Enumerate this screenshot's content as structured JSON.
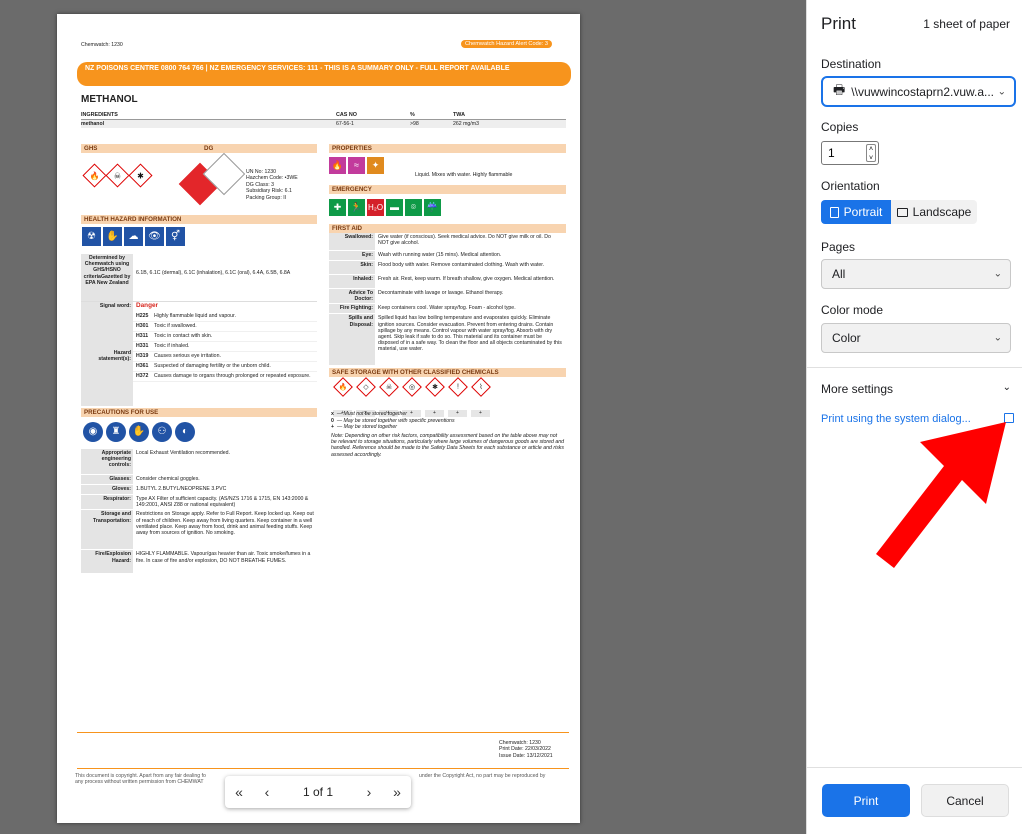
{
  "document": {
    "chemwatch_id": "Chemwatch: 1230",
    "alert_code": "Chemwatch Hazard Alert Code: 3",
    "banner": "NZ POISONS CENTRE 0800 764 766 | NZ EMERGENCY SERVICES: 111 - THIS IS A SUMMARY ONLY - FULL REPORT AVAILABLE",
    "title": "METHANOL",
    "ingredients_headers": [
      "INGREDIENTS",
      "CAS NO",
      "%",
      "TWA"
    ],
    "ingredients_row": [
      "methanol",
      "67-56-1",
      ">98",
      "262 mg/m3"
    ],
    "ghs_label": "GHS",
    "dg_label": "DG",
    "dg_info": [
      "UN No: 1230",
      "Hazchem Code: •3WE",
      "DG Class: 3",
      "Subsidiary Risk: 6.1",
      "Packing Group: II"
    ],
    "health_header": "HEALTH HAZARD INFORMATION",
    "determined_label": "Determined by Chemwatch using GHS/HSNO criteriaGazetted by EPA New Zealand",
    "determined_value": "6.1B, 6.1C (dermal), 6.1C (inhalation), 6.1C (oral), 6.4A, 6.5B, 6.8A",
    "signal_label": "Signal word:",
    "signal_value": "Danger",
    "hazard_label": "Hazard statement(s):",
    "hazards": [
      {
        "code": "H225",
        "text": "Highly flammable liquid and vapour."
      },
      {
        "code": "H301",
        "text": "Toxic if swallowed."
      },
      {
        "code": "H311",
        "text": "Toxic in contact with skin."
      },
      {
        "code": "H331",
        "text": "Toxic if inhaled."
      },
      {
        "code": "H319",
        "text": "Causes serious eye irritation."
      },
      {
        "code": "H361",
        "text": "Suspected of damaging fertility or the unborn child."
      },
      {
        "code": "H372",
        "text": "Causes damage to organs through prolonged or repeated exposure."
      }
    ],
    "precautions_header": "PRECAUTIONS FOR USE",
    "precautions": [
      {
        "label": "Appropriate engineering controls:",
        "value": "Local Exhaust Ventilation recommended."
      },
      {
        "label": "Glasses:",
        "value": "Consider chemical goggles."
      },
      {
        "label": "Gloves:",
        "value": "1.BUTYL 2.BUTYL/NEOPRENE 3.PVC"
      },
      {
        "label": "Respirator:",
        "value": "Type AX Filter of sufficient capacity. (AS/NZS 1716 & 1715, EN 143:2000 & 149:2001, ANSI Z88 or national equivalent)"
      },
      {
        "label": "Storage and Transportation:",
        "value": "Restrictions on Storage apply. Refer to Full Report. Keep locked up. Keep out of reach of children. Keep away from living quarters. Keep container in a well ventilated place. Keep away from food, drink and animal feeding stuffs. Keep away from sources of ignition. No smoking."
      },
      {
        "label": "Fire/Explosion Hazard:",
        "value": "HIGHLY FLAMMABLE. Vapour/gas heavier than air. Toxic smoke/fumes in a fire. In case of fire and/or explosion, DO NOT BREATHE FUMES."
      }
    ],
    "properties_header": "PROPERTIES",
    "properties_text": "Liquid. Mixes with water. Highly flammable",
    "emergency_header": "EMERGENCY",
    "firstaid_header": "FIRST AID",
    "firstaid": [
      {
        "label": "Swallowed:",
        "value": "Give water (if conscious). Seek medical advice. Do NOT give milk or oil. Do NOT give alcohol."
      },
      {
        "label": "Eye:",
        "value": "Wash with running water (15 mins). Medical attention."
      },
      {
        "label": "Skin:",
        "value": "Flood body with water. Remove contaminated clothing. Wash with water."
      },
      {
        "label": "Inhaled:",
        "value": "Fresh air. Rest, keep warm. If breath shallow, give oxygen. Medical attention."
      },
      {
        "label": "Advice To Doctor:",
        "value": "Decontaminate with lavage or lavage. Ethanol therapy."
      },
      {
        "label": "Fire Fighting:",
        "value": "Keep containers cool. Water spray/fog. Foam - alcohol type."
      },
      {
        "label": "Spills and Disposal:",
        "value": "Spilled liquid has low boiling temperature and evaporates quickly. Eliminate ignition sources. Consider evacuation. Prevent from entering drains. Contain spillage by any means. Control vapour with water spray/fog. Absorb with dry agent. Skip leak if safe to do so. This material and its container must be disposed of in a safe way. To clean the floor and all objects contaminated by this material, use water."
      }
    ],
    "storage_header": "SAFE STORAGE WITH OTHER CLASSIFIED CHEMICALS",
    "storage_symbols": [
      "+",
      "x",
      "+",
      "+",
      "+",
      "+",
      "+"
    ],
    "legend": [
      {
        "sym": "x",
        "text": "— Must not be stored together"
      },
      {
        "sym": "0",
        "text": "— May be stored together with specific preventions"
      },
      {
        "sym": "+",
        "text": "— May be stored together"
      }
    ],
    "note": "Note: Depending on other risk factors, compatibility assessment based on the table above may not be relevant to storage situations, particularly where large volumes of dangerous goods are stored and handled. Reference should be made to the Safety Data Sheets for each substance or article and risks assessed accordingly.",
    "footer_info": [
      "Chemwatch: 1230",
      "Print Date: 22/03/2022",
      "Issue Date: 13/12/2021"
    ],
    "copyright_left": "This document is copyright. Apart from any fair dealing fo",
    "copyright_left2": "any process without written permission from CHEMWAT",
    "copyright_right": "under the Copyright Act, no part may be reproduced by"
  },
  "pager": {
    "first": "«",
    "prev": "‹",
    "page": "1 of 1",
    "next": "›",
    "last": "»"
  },
  "panel": {
    "title": "Print",
    "sheets": "1 sheet of paper",
    "destination_label": "Destination",
    "destination_value": "\\\\vuwwincostaprn2.vuw.a...",
    "copies_label": "Copies",
    "copies_value": "1",
    "orientation_label": "Orientation",
    "portrait": "Portrait",
    "landscape": "Landscape",
    "pages_label": "Pages",
    "pages_value": "All",
    "color_label": "Color mode",
    "color_value": "Color",
    "more_settings": "More settings",
    "system_dialog": "Print using the system dialog...",
    "print_button": "Print",
    "cancel_button": "Cancel"
  },
  "colors": {
    "accent": "#1a73e8",
    "banner": "#f7941d",
    "arrow": "#ff0000"
  }
}
